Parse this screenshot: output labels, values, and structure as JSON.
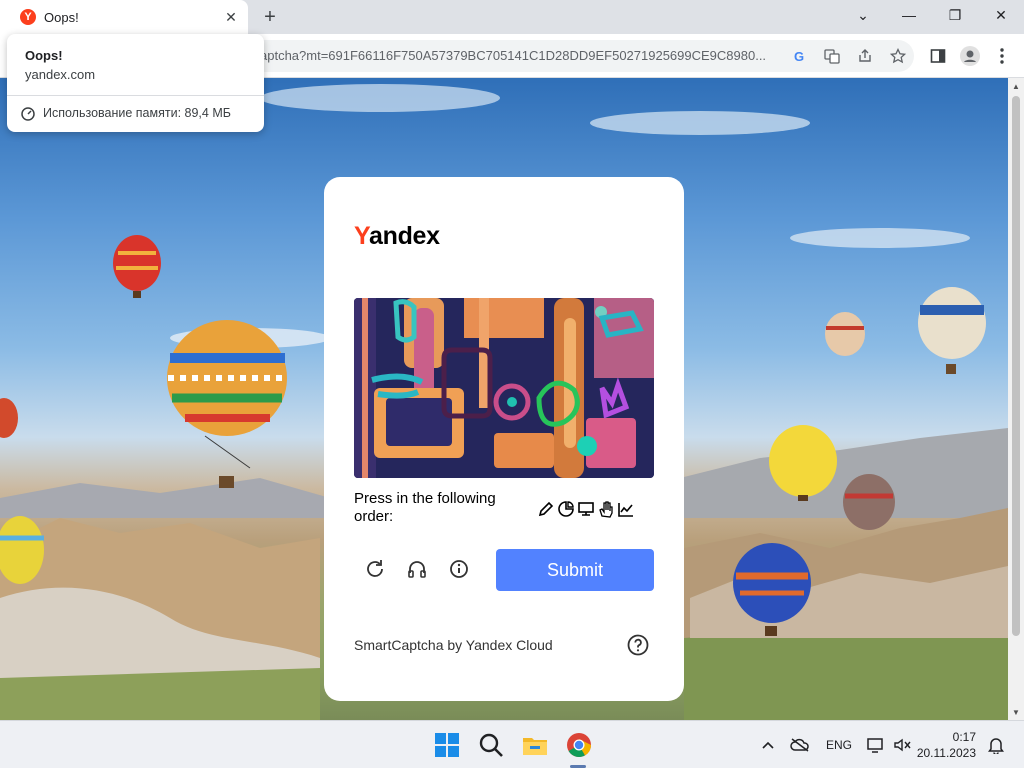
{
  "browser": {
    "tab": {
      "title": "Oops!",
      "favicon": "yandex-icon"
    },
    "new_tab_icon": "+",
    "window_controls": {
      "collapse": "⌄",
      "minimize": "—",
      "restore": "❐",
      "close": "✕"
    },
    "url": "aptcha?mt=691F66116F750A57379BC705141C1D28DD9EF50271925699CE9C8980...",
    "hover_card": {
      "title": "Oops!",
      "domain": "yandex.com",
      "memory": "Использование памяти: 89,4 МБ"
    }
  },
  "captcha": {
    "logo": {
      "first_letter": "Y",
      "rest": "andex"
    },
    "instruction": "Press in the following order:",
    "order_icons": [
      "pencil-icon",
      "pie-icon",
      "monitor-icon",
      "hand-icon",
      "chart-icon"
    ],
    "actions": [
      "refresh-icon",
      "headphones-icon",
      "info-icon"
    ],
    "submit_label": "Submit",
    "footer": "SmartCaptcha by Yandex Cloud",
    "accent_color": "#5282ff"
  },
  "taskbar": {
    "apps": [
      "windows-start-icon",
      "search-icon",
      "file-explorer-icon",
      "chrome-icon"
    ],
    "language": "ENG",
    "time": "0:17",
    "date": "20.11.2023"
  }
}
